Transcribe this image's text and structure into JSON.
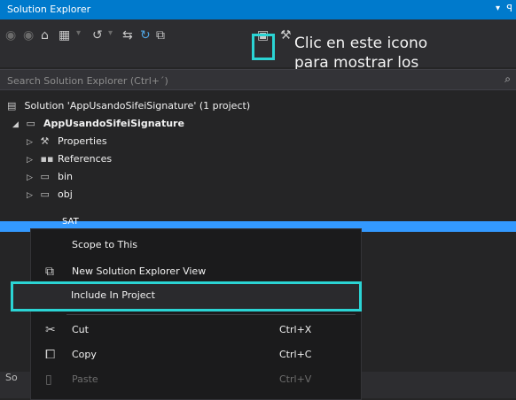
{
  "window": {
    "title": "Solution Explorer",
    "pin_glyph": "▾",
    "pin2_glyph": "ꟼ"
  },
  "toolbar": {
    "icons": [
      "back-icon",
      "forward-icon",
      "home-icon",
      "switch-views-icon",
      "history-icon",
      "sync-icon",
      "refresh-icon",
      "collapse-icon",
      "show-all-files-icon",
      "properties-wrench-icon"
    ]
  },
  "callout": {
    "text": "Clic en este icono\npara mostrar los\narchivos copiados"
  },
  "search": {
    "placeholder": "Search Solution Explorer (Ctrl+´)"
  },
  "tree": {
    "solution": "Solution 'AppUsandoSifeiSignature' (1 project)",
    "project": "AppUsandoSifeiSignature",
    "items": [
      "Properties",
      "References",
      "bin",
      "obj"
    ],
    "selected": "SAT"
  },
  "context_menu": {
    "items": [
      {
        "label": "Scope to This",
        "shortcut": ""
      },
      {
        "label": "New Solution Explorer View",
        "shortcut": ""
      },
      {
        "label": "Include In Project",
        "shortcut": ""
      },
      {
        "label": "Cut",
        "shortcut": "Ctrl+X"
      },
      {
        "label": "Copy",
        "shortcut": "Ctrl+C"
      },
      {
        "label": "Paste",
        "shortcut": "Ctrl+V"
      }
    ]
  },
  "bottom_tab": {
    "label": "So"
  },
  "colors": {
    "accent": "#007acc",
    "highlight": "#2bd4d4",
    "selection": "#3399ff"
  }
}
